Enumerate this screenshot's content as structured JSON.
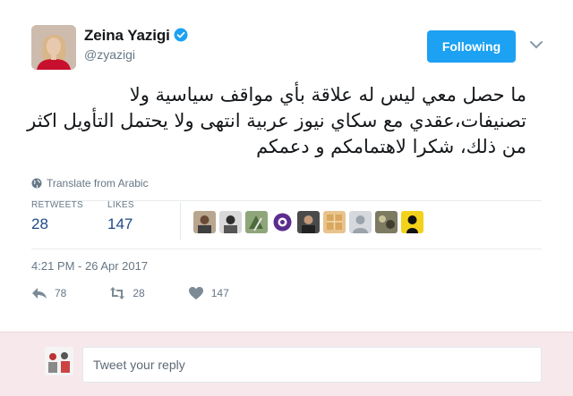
{
  "author": {
    "name": "Zeina Yazigi",
    "handle": "@zyazigi",
    "verified_icon": "verified-badge-icon"
  },
  "follow_button": {
    "label": "Following"
  },
  "tweet": {
    "text": "ما حصل معي ليس له علاقة بأي مواقف سياسية ولا تصنيفات،عقدي مع سكاي نيوز عربية انتهى ولا يحتمل التأويل اكثر من ذلك، شكرا لاهتمامكم و دعمكم",
    "translate_label": "Translate from Arabic",
    "timestamp": "4:21 PM - 26 Apr 2017"
  },
  "stats": {
    "retweets_label": "RETWEETS",
    "retweets_value": "28",
    "likes_label": "LIKES",
    "likes_value": "147"
  },
  "actions": {
    "reply_count": "78",
    "retweet_count": "28",
    "like_count": "147"
  },
  "reply": {
    "placeholder": "Tweet your reply"
  },
  "colors": {
    "accent": "#1da1f2",
    "stat_number": "#1d4a86",
    "reply_bg": "#f7e8ec"
  }
}
